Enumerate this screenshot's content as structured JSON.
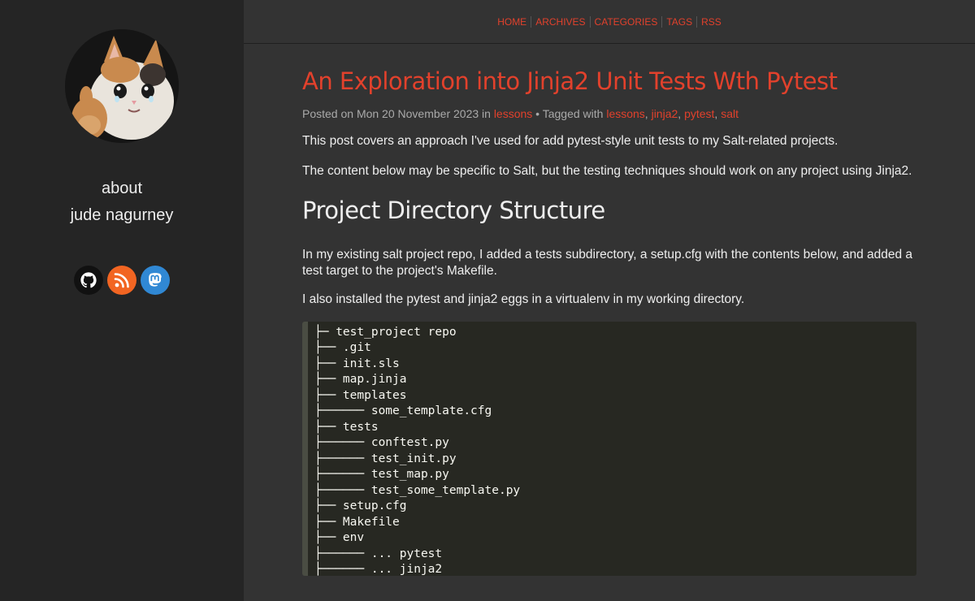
{
  "sidebar": {
    "about_label": "about",
    "author_name": "jude nagurney",
    "social": [
      {
        "icon": "github-icon",
        "color": "#111111"
      },
      {
        "icon": "rss-icon",
        "color": "#f26522"
      },
      {
        "icon": "mastodon-icon",
        "color": "#3088d4"
      }
    ]
  },
  "nav": {
    "items": [
      "HOME",
      "ARCHIVES",
      "CATEGORIES",
      "TAGS",
      "RSS"
    ]
  },
  "post": {
    "title": "An Exploration into Jinja2 Unit Tests Wth Pytest",
    "meta": {
      "posted_prefix": "Posted on Mon 20 November 2023 in ",
      "category": "lessons",
      "tagged_prefix": " • Tagged with ",
      "tags": [
        "lessons",
        "jinja2",
        "pytest",
        "salt"
      ]
    },
    "intro_1": "This post covers an approach I've used for add pytest-style unit tests to my Salt-related projects.",
    "intro_2": "The content below may be specific to Salt, but the testing techniques should work on any project using Jinja2.",
    "section_heading": "Project Directory Structure",
    "section_p1": "In my existing salt project repo, I added a tests subdirectory, a setup.cfg with the contents below, and added a test target to the project's Makefile.",
    "section_p2": "I also installed the pytest and jinja2 eggs in a virtualenv in my working directory.",
    "code_lines": [
      "├─ test_project repo",
      "├── .git",
      "├── init.sls",
      "├── map.jinja",
      "├── templates",
      "├────── some_template.cfg",
      "├── tests",
      "├────── conftest.py",
      "├────── test_init.py",
      "├────── test_map.py",
      "├────── test_some_template.py",
      "├── setup.cfg",
      "├── Makefile",
      "├── env",
      "├────── ... pytest",
      "├────── ... jinja2"
    ]
  },
  "colors": {
    "accent": "#e2412c",
    "sidebar_bg": "#252525",
    "main_bg": "#333333",
    "code_bg": "#272822"
  }
}
